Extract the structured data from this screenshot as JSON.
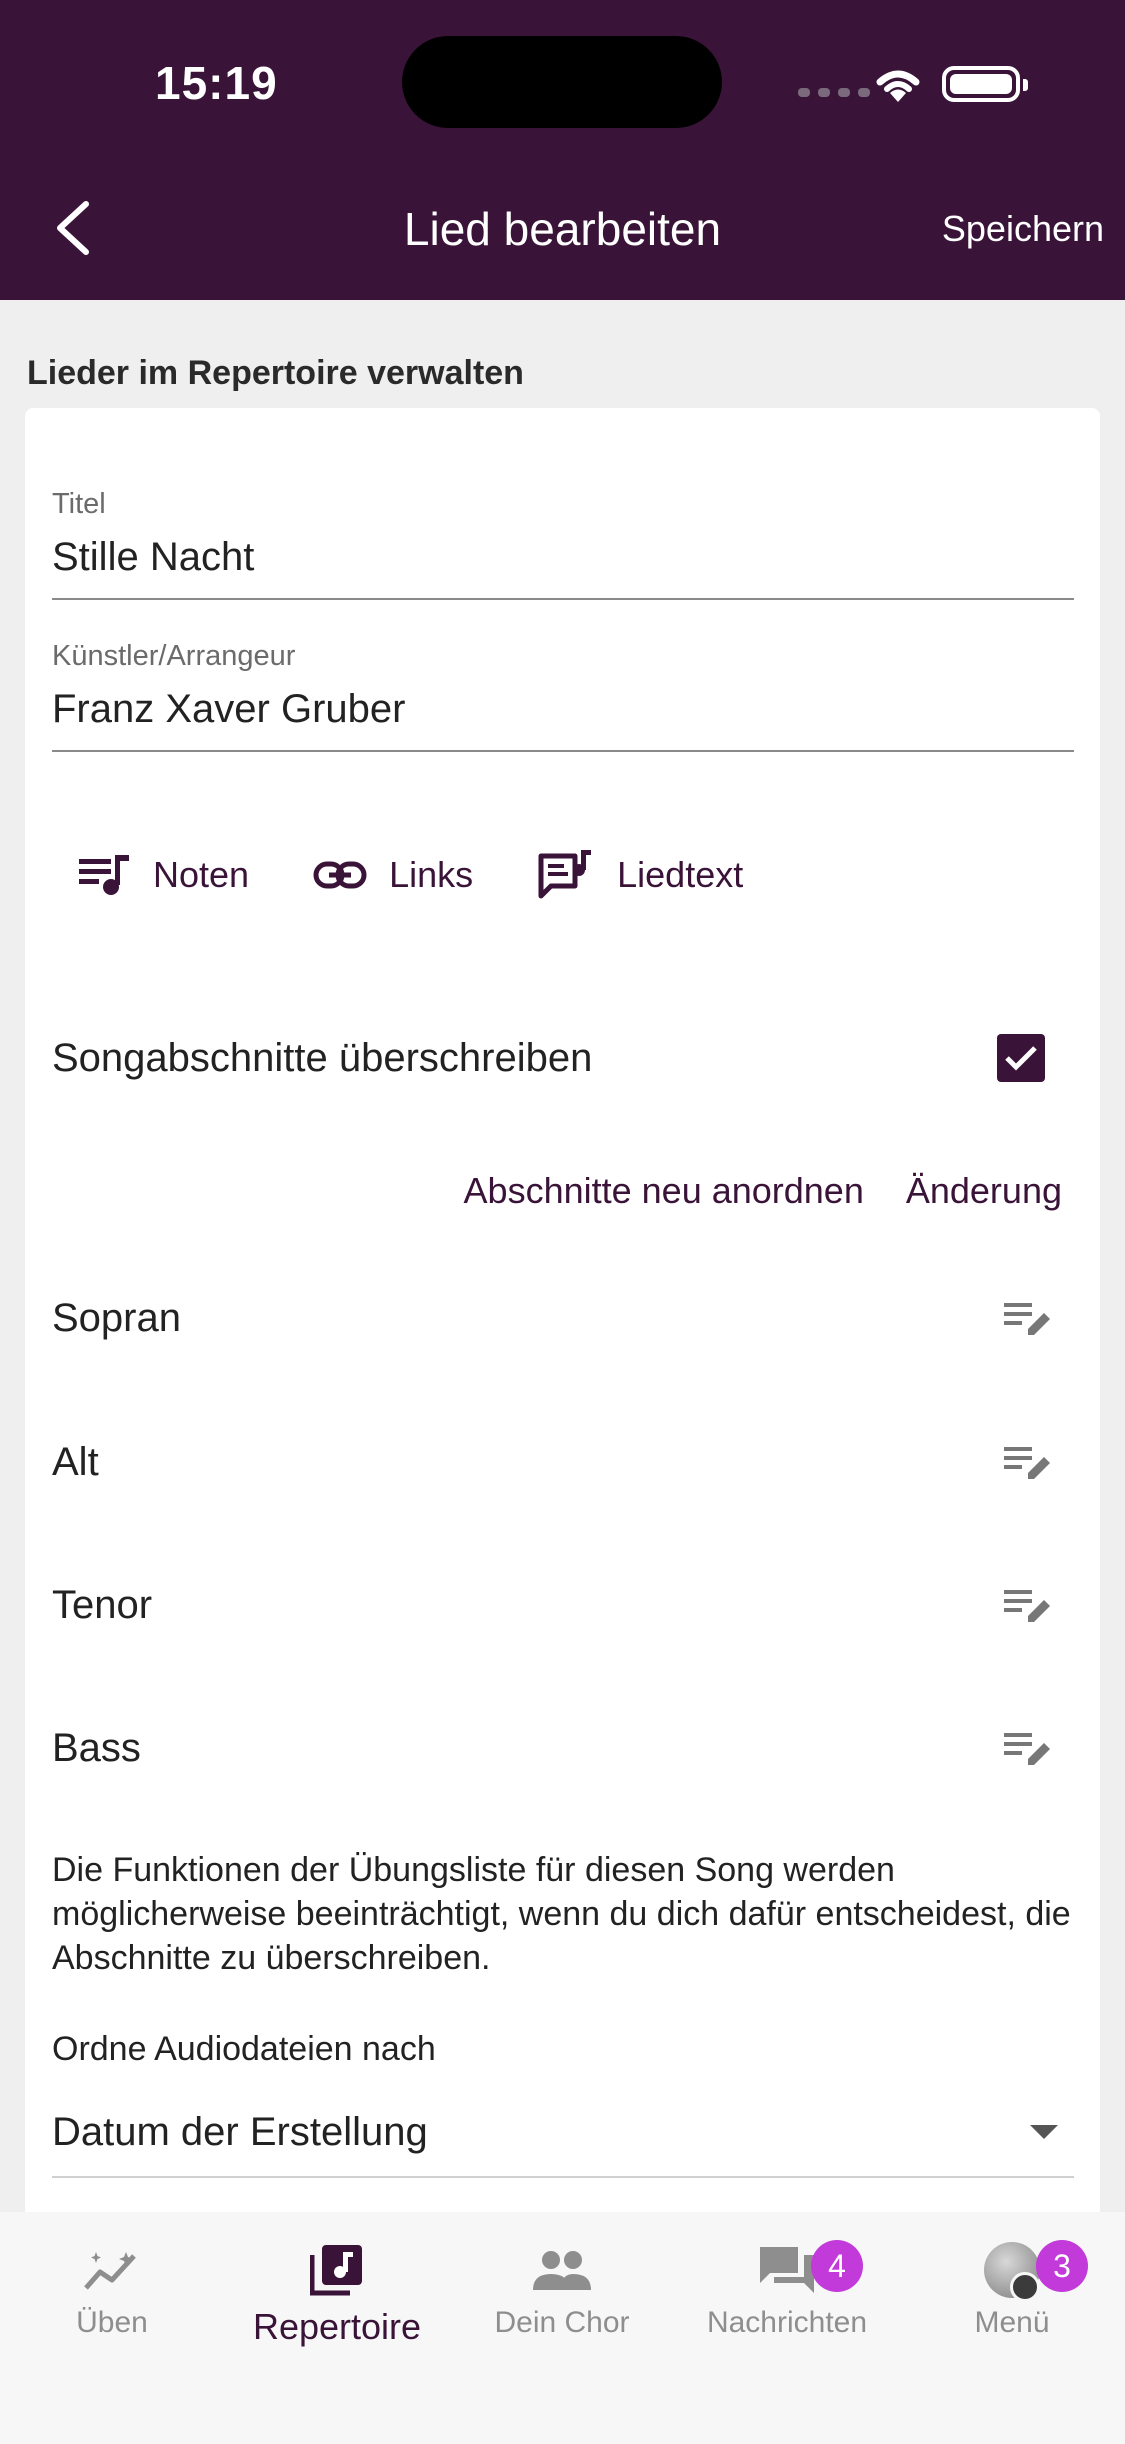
{
  "status_bar": {
    "time": "15:19"
  },
  "header": {
    "title": "Lied bearbeiten",
    "save_label": "Speichern"
  },
  "section_title": "Lieder im Repertoire verwalten",
  "fields": {
    "title": {
      "label": "Titel",
      "value": "Stille Nacht"
    },
    "artist": {
      "label": "Künstler/Arrangeur",
      "value": "Franz Xaver Gruber"
    }
  },
  "actions": {
    "sheet_music": "Noten",
    "links": "Links",
    "lyrics": "Liedtext"
  },
  "override_sections": {
    "label": "Songabschnitte überschreiben",
    "checked": true
  },
  "section_controls": {
    "reorder": "Abschnitte neu anordnen",
    "change": "Änderung"
  },
  "voices": [
    "Sopran",
    "Alt",
    "Tenor",
    "Bass"
  ],
  "note": "Die Funktionen der Übungsliste für diesen Song werden möglicherweise beeinträchtigt, wenn du dich dafür entscheidest, die Abschnitte zu überschreiben.",
  "sort": {
    "label": "Ordne Audiodateien nach",
    "selected": "Datum der Erstellung"
  },
  "bottom_nav": {
    "items": [
      {
        "label": "Üben",
        "icon": "practice-chart-icon"
      },
      {
        "label": "Repertoire",
        "icon": "music-library-icon",
        "active": true
      },
      {
        "label": "Dein Chor",
        "icon": "group-icon"
      },
      {
        "label": "Nachrichten",
        "icon": "chat-icon",
        "badge": "4"
      },
      {
        "label": "Menü",
        "icon": "avatar-icon",
        "badge": "3"
      }
    ]
  },
  "colors": {
    "primary": "#3a1438",
    "badge": "#c23ad9"
  }
}
